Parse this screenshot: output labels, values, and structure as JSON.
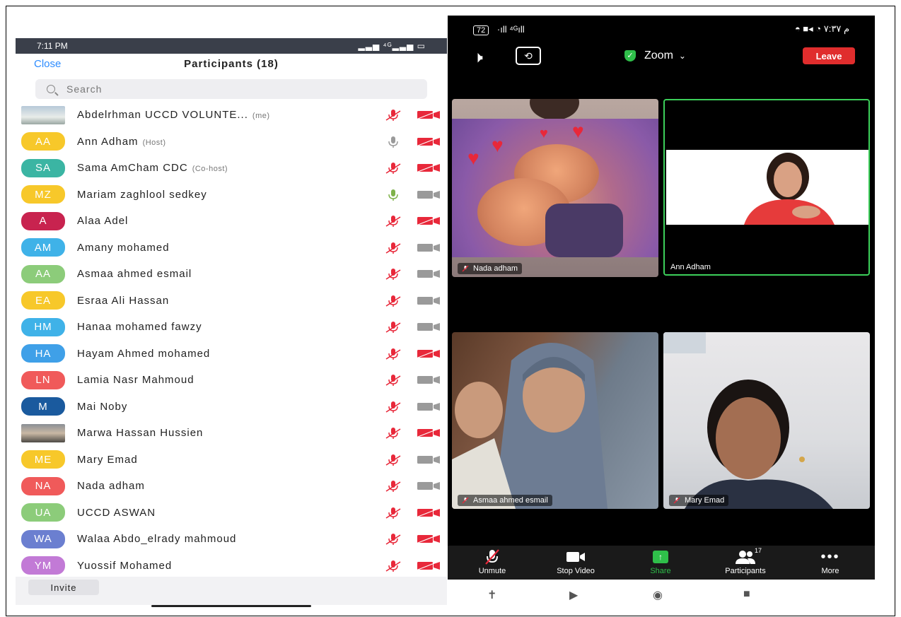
{
  "left_phone": {
    "status_time": "7:11 PM",
    "status_right": "▂▃▅ ⁴ᴳ▂▃▅ ▭",
    "close_label": "Close",
    "title": "Participants (18)",
    "search_placeholder": "Search",
    "participants": [
      {
        "initials": "",
        "name": "Abdelrhman UCCD VOLUNTE...",
        "role": "(me)",
        "avatar_color": "photo",
        "mic": "muted",
        "cam": "off"
      },
      {
        "initials": "AA",
        "name": "Ann Adham",
        "role": "(Host)",
        "avatar_color": "#f7c82a",
        "mic": "on-gray",
        "cam": "off"
      },
      {
        "initials": "SA",
        "name": "Sama AmCham CDC",
        "role": "(Co-host)",
        "avatar_color": "#3bb5a3",
        "mic": "muted",
        "cam": "off"
      },
      {
        "initials": "MZ",
        "name": "Mariam zaghlool sedkey",
        "role": "",
        "avatar_color": "#f7c82a",
        "mic": "on-green",
        "cam": "on"
      },
      {
        "initials": "A",
        "name": "Alaa Adel",
        "role": "",
        "avatar_color": "#c8234f",
        "mic": "muted",
        "cam": "off"
      },
      {
        "initials": "AM",
        "name": "Amany mohamed",
        "role": "",
        "avatar_color": "#3fb2e8",
        "mic": "muted",
        "cam": "on"
      },
      {
        "initials": "AA",
        "name": "Asmaa ahmed esmail",
        "role": "",
        "avatar_color": "#8ccc7a",
        "mic": "muted",
        "cam": "on"
      },
      {
        "initials": "EA",
        "name": "Esraa Ali Hassan",
        "role": "",
        "avatar_color": "#f7c82a",
        "mic": "muted",
        "cam": "on"
      },
      {
        "initials": "HM",
        "name": "Hanaa mohamed fawzy",
        "role": "",
        "avatar_color": "#3fb2e8",
        "mic": "muted",
        "cam": "on"
      },
      {
        "initials": "HA",
        "name": "Hayam Ahmed mohamed",
        "role": "",
        "avatar_color": "#3fa0e8",
        "mic": "muted",
        "cam": "off"
      },
      {
        "initials": "LN",
        "name": "Lamia Nasr Mahmoud",
        "role": "",
        "avatar_color": "#f05a5a",
        "mic": "muted",
        "cam": "on"
      },
      {
        "initials": "M",
        "name": "Mai Noby",
        "role": "",
        "avatar_color": "#1a5a9e",
        "mic": "muted",
        "cam": "on"
      },
      {
        "initials": "",
        "name": "Marwa Hassan Hussien",
        "role": "",
        "avatar_color": "photo2",
        "mic": "muted",
        "cam": "off"
      },
      {
        "initials": "ME",
        "name": "Mary Emad",
        "role": "",
        "avatar_color": "#f7c82a",
        "mic": "muted",
        "cam": "on"
      },
      {
        "initials": "NA",
        "name": "Nada adham",
        "role": "",
        "avatar_color": "#f05a5a",
        "mic": "muted",
        "cam": "on"
      },
      {
        "initials": "UA",
        "name": "UCCD ASWAN",
        "role": "",
        "avatar_color": "#8ccc7a",
        "mic": "muted",
        "cam": "off"
      },
      {
        "initials": "WA",
        "name": "Walaa Abdo_elrady mahmoud",
        "role": "",
        "avatar_color": "#6b7fd0",
        "mic": "muted",
        "cam": "off"
      },
      {
        "initials": "YM",
        "name": "Yuossif Mohamed",
        "role": "",
        "avatar_color": "#c27ad6",
        "mic": "muted",
        "cam": "off"
      }
    ],
    "invite_label": "Invite"
  },
  "right_phone": {
    "status_left_battery": "72",
    "status_left_signal": "·ıll ⁴ᴳıll",
    "status_right": "◓ ■◂ ◔ م ٧:٣٧",
    "app_label": "Zoom",
    "leave_label": "Leave",
    "tiles": {
      "t1_name": "Nada adham",
      "t2_name": "Ann Adham",
      "t3_name": "Asmaa ahmed esmail",
      "t4_name": "Mary Emad"
    },
    "toolbar": {
      "unmute": "Unmute",
      "stop_video": "Stop Video",
      "share": "Share",
      "participants": "Participants",
      "participants_count": "17",
      "more": "More"
    }
  },
  "colors": {
    "accent_blue": "#2d8cff",
    "leave_red": "#e02d2d",
    "share_green": "#2fbf4a",
    "muted_red": "#e8283a"
  }
}
